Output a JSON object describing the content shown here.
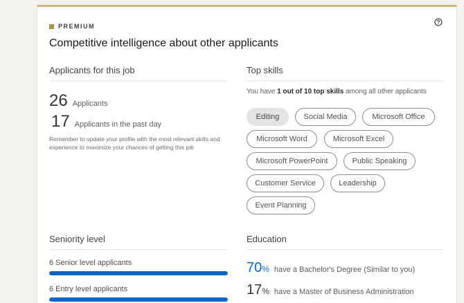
{
  "header": {
    "badge": "PREMIUM",
    "title": "Competitive intelligence about other applicants"
  },
  "applicants": {
    "section_title": "Applicants for this job",
    "total_count": "26",
    "total_label": "Applicants",
    "recent_count": "17",
    "recent_label": "Applicants in the past day",
    "note": "Remember to update your profile with the most relevant skills and experience to maximize your chances of getting this job"
  },
  "skills": {
    "section_title": "Top skills",
    "intro_prefix": "You have ",
    "intro_bold": "1 out of 10 top skills",
    "intro_suffix": " among all other applicants",
    "items": [
      {
        "label": "Editing",
        "matched": true
      },
      {
        "label": "Social Media",
        "matched": false
      },
      {
        "label": "Microsoft Office",
        "matched": false
      },
      {
        "label": "Microsoft Word",
        "matched": false
      },
      {
        "label": "Microsoft Excel",
        "matched": false
      },
      {
        "label": "Microsoft PowerPoint",
        "matched": false
      },
      {
        "label": "Public Speaking",
        "matched": false
      },
      {
        "label": "Customer Service",
        "matched": false
      },
      {
        "label": "Leadership",
        "matched": false
      },
      {
        "label": "Event Planning",
        "matched": false
      }
    ]
  },
  "seniority": {
    "section_title": "Seniority level",
    "items": [
      {
        "label": "6 Senior level applicants",
        "fill": 1.0
      },
      {
        "label": "6 Entry level applicants",
        "fill": 1.0
      }
    ]
  },
  "education": {
    "section_title": "Education",
    "items": [
      {
        "percent": "70",
        "symbol": "%",
        "text": "have a Bachelor's Degree (Similar to you)"
      },
      {
        "percent": "17",
        "symbol": "%",
        "text": "have a Master of Business Administration"
      }
    ]
  },
  "colors": {
    "accent": "#0a66c2",
    "premium_gold": "#a8924d",
    "selected_pill": "#e2e4e6"
  },
  "icons": {
    "help": "help-icon"
  }
}
